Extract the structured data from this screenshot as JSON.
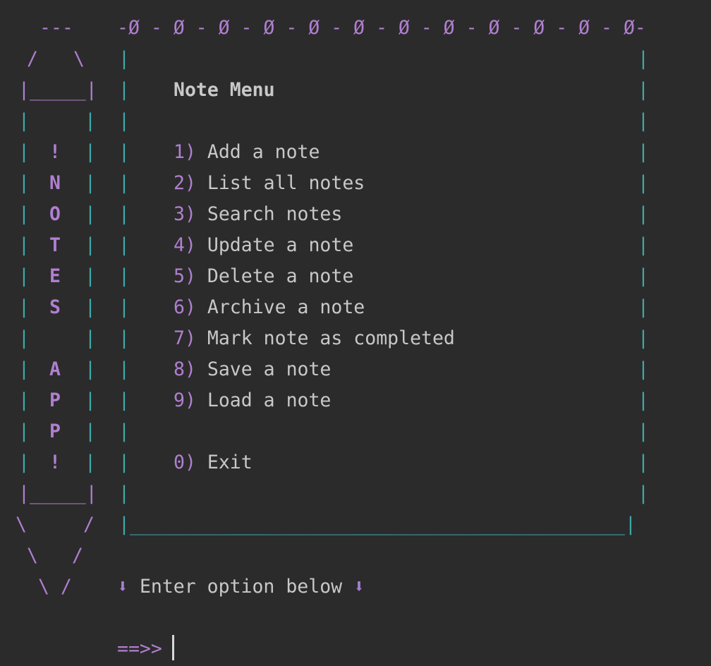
{
  "banner": {
    "top_border": "-Ø - Ø - Ø - Ø - Ø - Ø - Ø - Ø - Ø - Ø - Ø - Ø-",
    "bottom_border": "|____________________________________________|"
  },
  "pencil": {
    "tip_top": "---",
    "letters": [
      "!",
      "N",
      "O",
      "T",
      "E",
      "S",
      "",
      "A",
      "P",
      "P",
      "!"
    ]
  },
  "menu": {
    "title": "Note Menu",
    "items": [
      {
        "key": "1)",
        "label": "Add a note"
      },
      {
        "key": "2)",
        "label": "List all notes"
      },
      {
        "key": "3)",
        "label": "Search notes"
      },
      {
        "key": "4)",
        "label": "Update a note"
      },
      {
        "key": "5)",
        "label": "Delete a note"
      },
      {
        "key": "6)",
        "label": "Archive a note"
      },
      {
        "key": "7)",
        "label": "Mark note as completed"
      },
      {
        "key": "8)",
        "label": "Save a note"
      },
      {
        "key": "9)",
        "label": "Load a note"
      }
    ],
    "exit": {
      "key": "0)",
      "label": "Exit"
    }
  },
  "prompt": {
    "hint": "Enter option below",
    "arrow_icon": "⬇",
    "prompt_symbol": "==>>"
  },
  "colors": {
    "background": "#2b2b2b",
    "accent_purple": "#b07fd1",
    "border_teal": "#3fa7a8",
    "text": "#c8c8c8"
  }
}
